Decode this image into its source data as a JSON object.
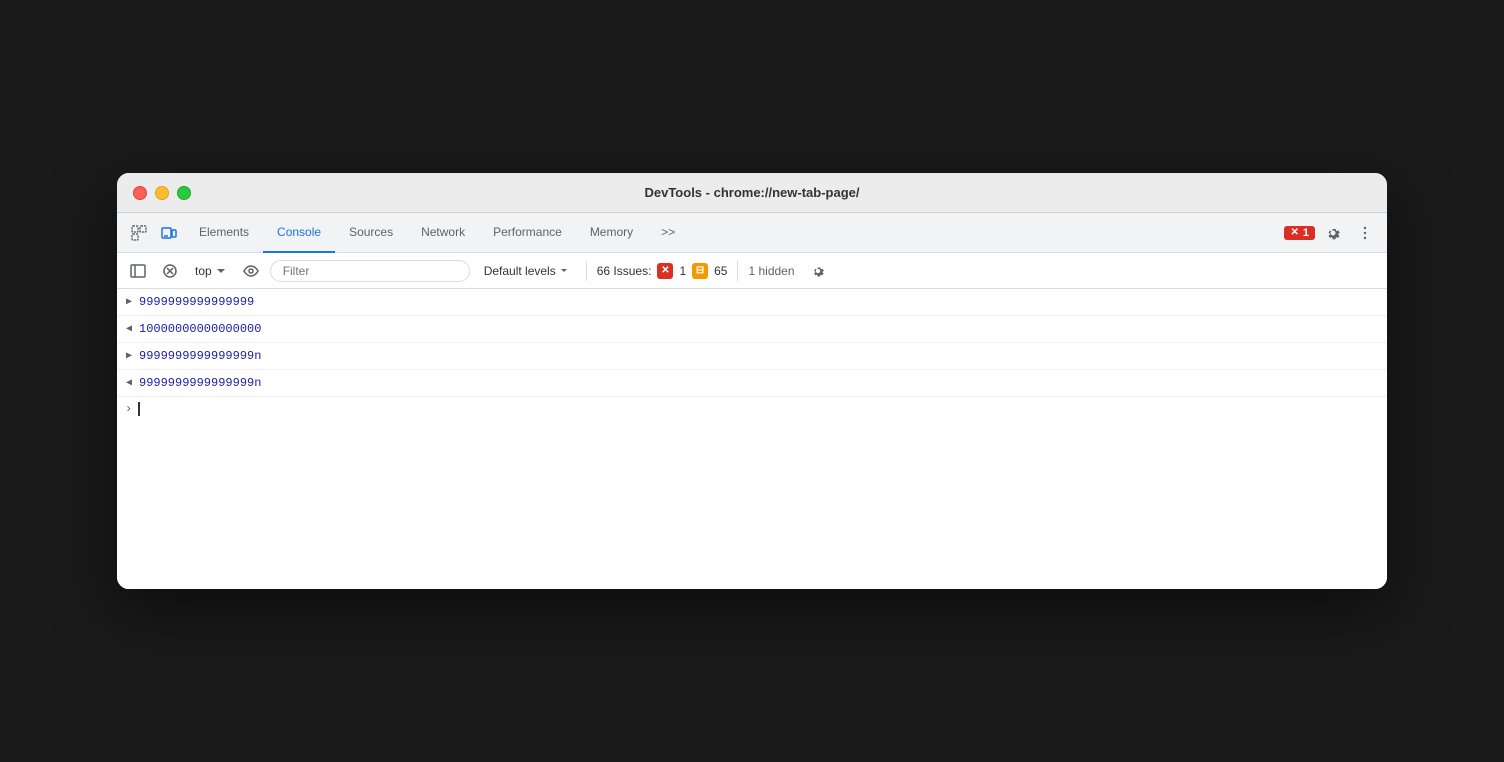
{
  "window": {
    "title": "DevTools - chrome://new-tab-page/"
  },
  "tabs": {
    "items": [
      {
        "label": "Elements",
        "active": false
      },
      {
        "label": "Console",
        "active": true
      },
      {
        "label": "Sources",
        "active": false
      },
      {
        "label": "Network",
        "active": false
      },
      {
        "label": "Performance",
        "active": false
      },
      {
        "label": "Memory",
        "active": false
      },
      {
        "label": ">>",
        "active": false
      }
    ],
    "error_badge": "1",
    "error_badge_prefix": "✕"
  },
  "toolbar": {
    "top_label": "top",
    "filter_placeholder": "Filter",
    "levels_label": "Default levels",
    "issues_label": "66 Issues:",
    "error_count": "1",
    "warn_count": "65",
    "hidden_label": "1 hidden"
  },
  "console_lines": [
    {
      "type": "output",
      "chevron": "▶",
      "value": "9999999999999999"
    },
    {
      "type": "return",
      "chevron": "◀",
      "value": "10000000000000000"
    },
    {
      "type": "output",
      "chevron": "▶",
      "value": "9999999999999999n"
    },
    {
      "type": "return",
      "chevron": "◀",
      "value": "9999999999999999n"
    }
  ]
}
